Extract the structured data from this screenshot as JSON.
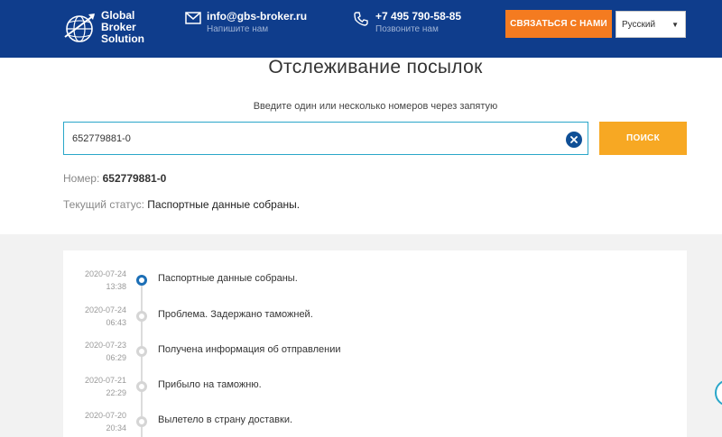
{
  "header": {
    "brand": [
      "Global",
      "Broker",
      "Solution"
    ],
    "email": {
      "value": "info@gbs-broker.ru",
      "caption": "Напишите нам",
      "icon": "envelope-icon"
    },
    "phone": {
      "value": "+7 495 790-58-85",
      "caption": "Позвоните нам",
      "icon": "phone-icon"
    },
    "cta_label": "СВЯЗАТЬСЯ С НАМИ",
    "language": "Русский",
    "colors": {
      "header_bg": "#0f3d8c",
      "cta": "#f47b20",
      "search": "#f7a823",
      "accent": "#1c6fb6"
    }
  },
  "tracking": {
    "title": "Отслеживание посылок",
    "instruction": "Введите один или несколько номеров через запятую",
    "input_value": "652779881-0",
    "search_label": "ПОИСК",
    "number_label": "Номер:",
    "number_value": "652779881-0",
    "status_label": "Текущий статус:",
    "status_value": "Паспортные данные собраны."
  },
  "timeline": [
    {
      "date": "2020-07-24",
      "time": "13:38",
      "text": "Паспортные данные собраны.",
      "active": true
    },
    {
      "date": "2020-07-24",
      "time": "06:43",
      "text": "Проблема. Задержано таможней.",
      "active": false
    },
    {
      "date": "2020-07-23",
      "time": "06:29",
      "text": "Получена информация об отправлении",
      "active": false
    },
    {
      "date": "2020-07-21",
      "time": "22:29",
      "text": "Прибыло на таможню.",
      "active": false
    },
    {
      "date": "2020-07-20",
      "time": "20:34",
      "text": "Вылетело в страну доставки.",
      "active": false
    }
  ]
}
